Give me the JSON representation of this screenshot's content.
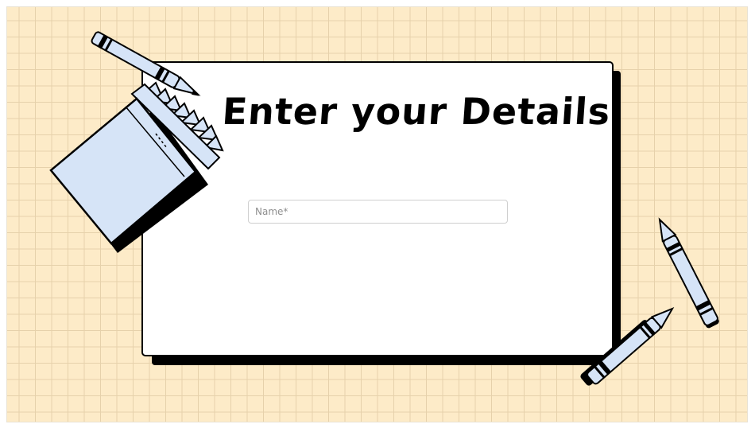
{
  "form": {
    "title": "Enter your Details",
    "name_field": {
      "placeholder": "Name*",
      "value": ""
    }
  },
  "decorations": {
    "icons": [
      "crayon-box-icon",
      "crayon-icon",
      "crayon-icon",
      "crayon-icon"
    ]
  },
  "colors": {
    "background": "#fdebc8",
    "grid_lines": "#e6d1ab",
    "card": "#ffffff",
    "card_shadow": "#000000",
    "crayon_fill": "#d6e4f7",
    "outline": "#000000"
  }
}
